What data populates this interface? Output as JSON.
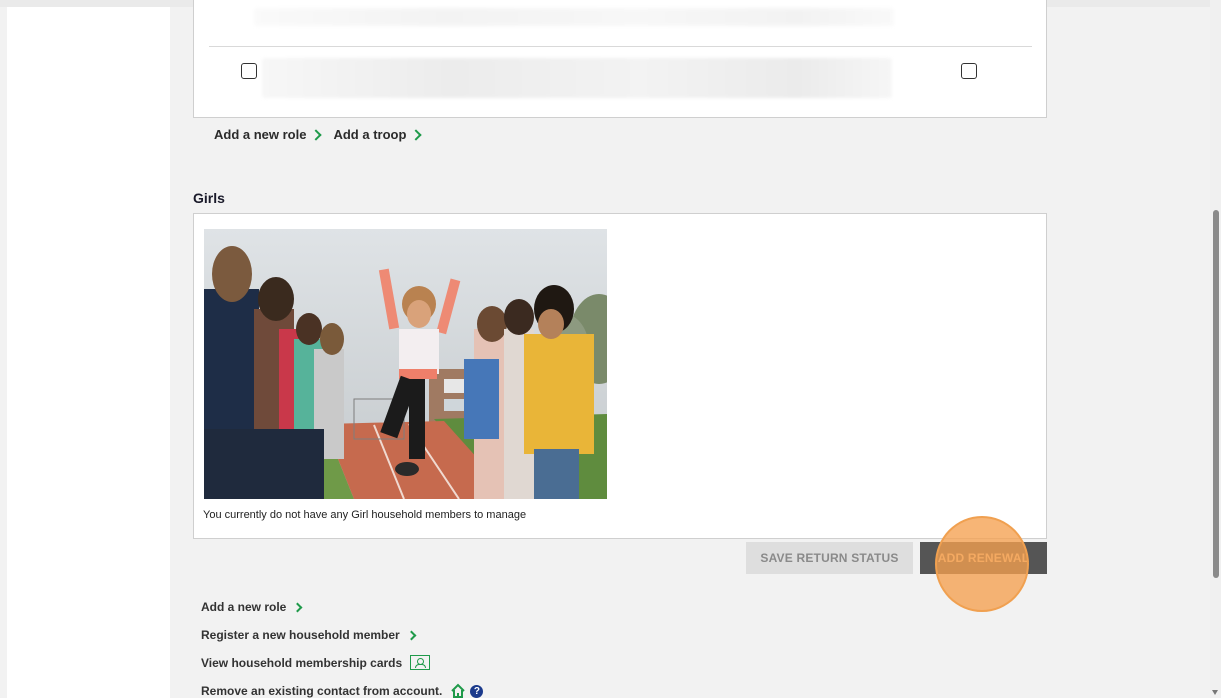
{
  "roles": {
    "links": [
      {
        "label": "Add a new role"
      },
      {
        "label": "Add a troop"
      }
    ]
  },
  "girls": {
    "title": "Girls",
    "empty_message": "You currently do not have any Girl household members to manage"
  },
  "actions": {
    "save_return_status": "SAVE RETURN STATUS",
    "add_renewal": "ADD RENEWAL"
  },
  "bottom_links": [
    {
      "label": "Add a new role",
      "icon": "chevron-right-icon"
    },
    {
      "label": "Register a new household member",
      "icon": "chevron-right-icon"
    },
    {
      "label": "View household membership cards",
      "icon": "membership-card-icon"
    },
    {
      "label": "Remove an existing contact from account.",
      "icon": "home-icon"
    }
  ],
  "colors": {
    "accent_green": "#1f9a4a",
    "button_dark": "#555555",
    "button_disabled": "#dedede",
    "click_highlight": "#f5a050",
    "help_blue": "#1b3a8c"
  }
}
